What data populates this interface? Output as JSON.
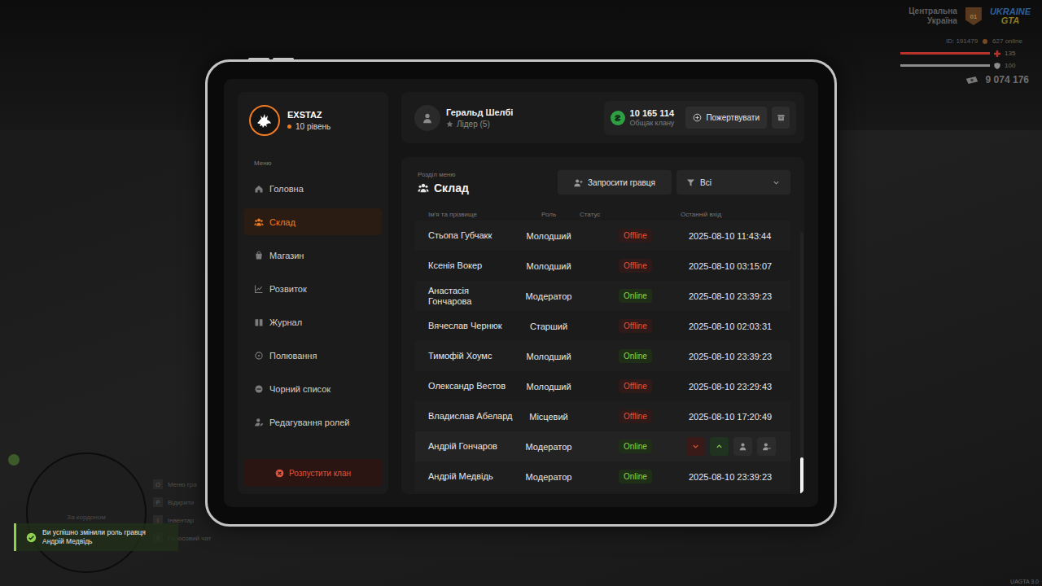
{
  "hud": {
    "region": [
      "Центральна",
      "Україна"
    ],
    "region_badge": "01",
    "brand": [
      "UKRAINE",
      "GTA"
    ],
    "player_id": "ID: 191479",
    "online": "627 online",
    "stats": [
      {
        "kind": "health",
        "value": "135",
        "level": 1,
        "color": "#b8322c"
      },
      {
        "kind": "armor",
        "value": "100",
        "level": 1,
        "color": "#8c8c8c"
      }
    ],
    "money": "9 074 176"
  },
  "minimap": {
    "label": "За кордоном"
  },
  "hints": [
    {
      "key": "O",
      "label": "Меню гра"
    },
    {
      "key": "P",
      "label": "Відкрити"
    },
    {
      "key": "I",
      "label": "Інвентар"
    },
    {
      "key": "X",
      "label": "Голосовий чат"
    }
  ],
  "notification": {
    "lines": [
      "Ви успішно змінили роль гравця",
      "Андрій Медвідь"
    ]
  },
  "version": "UAGTA 3.0",
  "clan": {
    "name": "EXSTAZ",
    "level": "10 рівень"
  },
  "sidebar": {
    "label": "Меню",
    "items": [
      {
        "label": "Головна",
        "selected": false
      },
      {
        "label": "Склад",
        "selected": true
      },
      {
        "label": "Магазин",
        "selected": false
      },
      {
        "label": "Розвиток",
        "selected": false
      },
      {
        "label": "Журнал",
        "selected": false
      },
      {
        "label": "Полювання",
        "selected": false
      },
      {
        "label": "Чорний список",
        "selected": false
      },
      {
        "label": "Редагування ролей",
        "selected": false
      }
    ],
    "disband": "Розпустити клан"
  },
  "user": {
    "name": "Геральд Шелбі",
    "rank": "Лідер (5)"
  },
  "treasury": {
    "currency": "₴",
    "amount": "10 165 114",
    "label": "Общак клану",
    "donate": "Пожертвувати"
  },
  "section": {
    "label": "Розділ меню",
    "title": "Склад",
    "invite": "Запросити гравця",
    "filter": "Всі"
  },
  "table": {
    "columns": [
      "Ім'я та прізвище",
      "Роль",
      "Статус",
      "Останній вхід"
    ],
    "rows": [
      {
        "name": "Стьопа Губчакк",
        "role": "Молодший",
        "status": "Offline",
        "online": false,
        "hovered": false,
        "last_login": "2025-08-10 11:43:44"
      },
      {
        "name": "Ксенія Вокер",
        "role": "Молодший",
        "status": "Offline",
        "online": false,
        "hovered": false,
        "last_login": "2025-08-10 03:15:07"
      },
      {
        "name": "Анастасія Гончарова",
        "role": "Модератор",
        "status": "Online",
        "online": true,
        "hovered": false,
        "last_login": "2025-08-10 23:39:23"
      },
      {
        "name": "Вячеслав Чернюк",
        "role": "Старший",
        "status": "Offline",
        "online": false,
        "hovered": false,
        "last_login": "2025-08-10 02:03:31"
      },
      {
        "name": "Тимофій Хоумс",
        "role": "Молодший",
        "status": "Online",
        "online": true,
        "hovered": false,
        "last_login": "2025-08-10 23:39:23"
      },
      {
        "name": "Олександр Вестов",
        "role": "Молодший",
        "status": "Offline",
        "online": false,
        "hovered": false,
        "last_login": "2025-08-10 23:29:43"
      },
      {
        "name": "Владислав Абелард",
        "role": "Місцевий",
        "status": "Offline",
        "online": false,
        "hovered": false,
        "last_login": "2025-08-10 17:20:49"
      },
      {
        "name": "Андрій Гончаров",
        "role": "Модератор",
        "status": "Online",
        "online": true,
        "hovered": true,
        "actions": [
          {
            "kind": "demote"
          },
          {
            "kind": "promote"
          },
          {
            "kind": "profile"
          },
          {
            "kind": "kick"
          }
        ]
      },
      {
        "name": "Андрій Медвідь",
        "role": "Модератор",
        "status": "Online",
        "online": true,
        "hovered": false,
        "last_login": "2025-08-10 23:39:23"
      }
    ]
  },
  "scrollbar": {
    "thumb": 0.14,
    "position": 1
  }
}
